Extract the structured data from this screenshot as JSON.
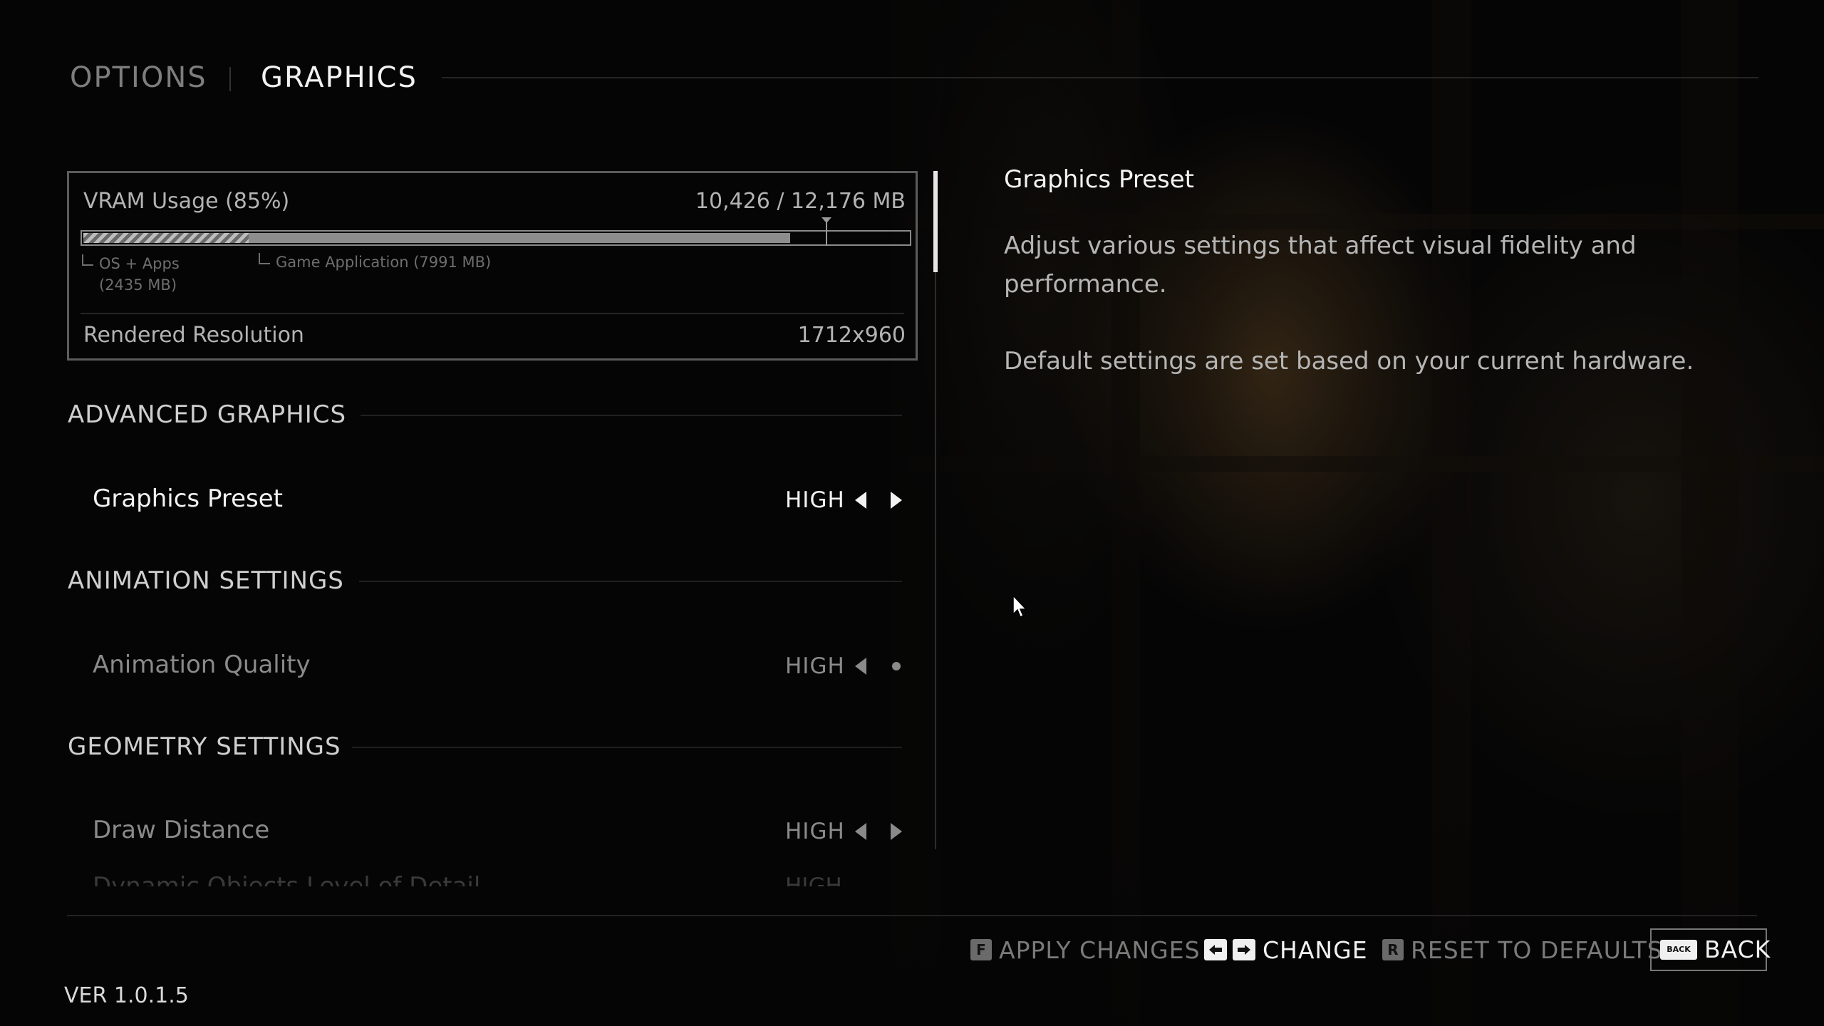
{
  "header": {
    "options_label": "OPTIONS",
    "graphics_label": "GRAPHICS"
  },
  "vram": {
    "title": "VRAM Usage (85%)",
    "usage_text": "10,426 / 12,176 MB",
    "usage_fraction": 0.856,
    "os_apps_fraction": 0.2,
    "game_app_fraction": 0.656,
    "marker_fraction": 0.9,
    "os_apps_label_line1": "OS + Apps",
    "os_apps_label_line2": "(2435 MB)",
    "game_app_label": "Game Application (7991 MB)",
    "resolution_label": "Rendered Resolution",
    "resolution_value": "1712x960"
  },
  "sections": {
    "advanced": {
      "title": "ADVANCED GRAPHICS",
      "rows": [
        {
          "label": "Graphics Preset",
          "value": "HIGH"
        }
      ]
    },
    "animation": {
      "title": "ANIMATION SETTINGS",
      "rows": [
        {
          "label": "Animation Quality",
          "value": "HIGH"
        }
      ]
    },
    "geometry": {
      "title": "GEOMETRY SETTINGS",
      "rows": [
        {
          "label": "Draw Distance",
          "value": "HIGH"
        },
        {
          "label": "Dynamic Objects Level of Detail",
          "value": "HIGH"
        }
      ]
    }
  },
  "description": {
    "title": "Graphics Preset",
    "paragraph1": "Adjust various settings that affect visual fidelity and performance.",
    "paragraph2": "Default settings are set based on your current hardware."
  },
  "footer": {
    "version": "VER 1.0.1.5",
    "apply_key": "F",
    "apply_label": "APPLY CHANGES",
    "change_label": "CHANGE",
    "reset_key": "R",
    "reset_label": "RESET TO DEFAULTS",
    "back_key": "BACK",
    "back_label": "BACK"
  },
  "colors": {
    "background": "#050505",
    "text_active": "#f2f2f2",
    "text_dim": "#8a8a8a",
    "accent_white": "#e6e6e6"
  }
}
